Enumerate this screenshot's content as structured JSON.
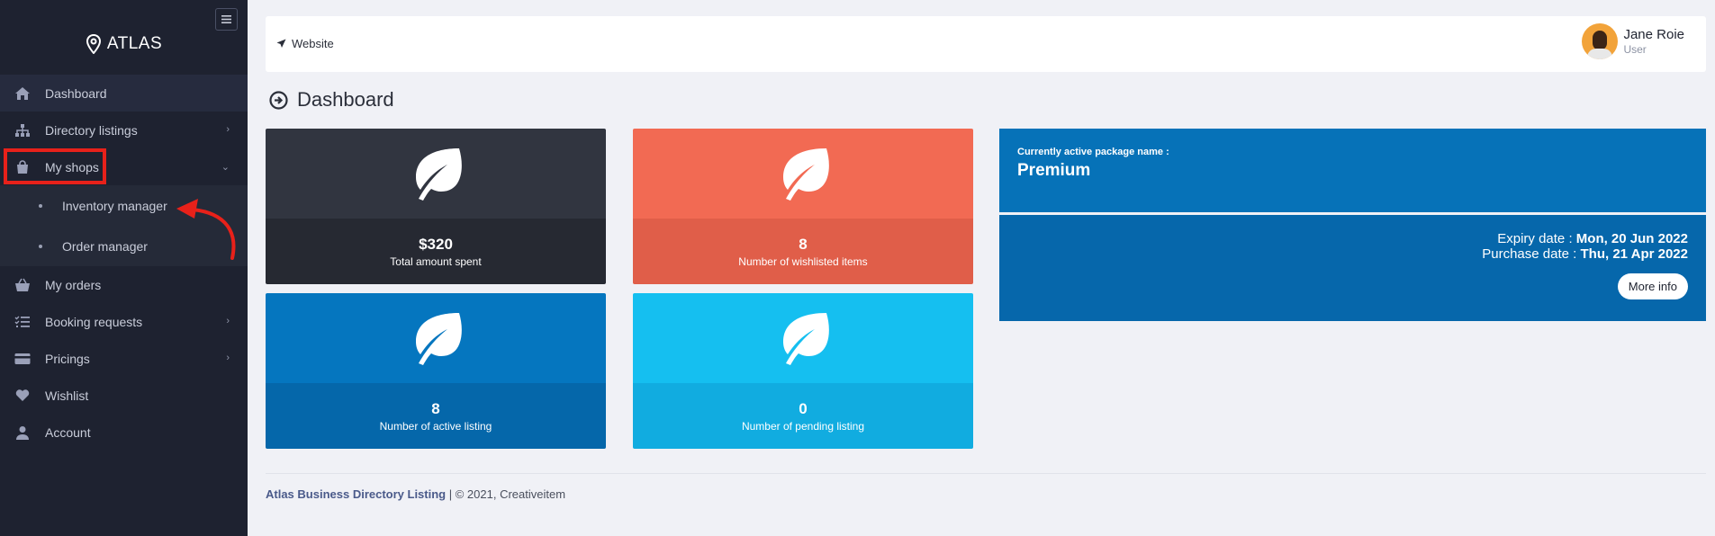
{
  "sidebar": {
    "brand": "ATLAS",
    "items": [
      {
        "label": "Dashboard",
        "icon": "home-icon"
      },
      {
        "label": "Directory listings",
        "icon": "sitemap-icon"
      },
      {
        "label": "My shops",
        "icon": "shopping-bag-icon"
      },
      {
        "label": "My orders",
        "icon": "basket-icon"
      },
      {
        "label": "Booking requests",
        "icon": "tasks-icon"
      },
      {
        "label": "Pricings",
        "icon": "credit-card-icon"
      },
      {
        "label": "Wishlist",
        "icon": "heart-icon"
      },
      {
        "label": "Account",
        "icon": "user-icon"
      }
    ],
    "submenu": [
      {
        "label": "Inventory manager"
      },
      {
        "label": "Order manager"
      }
    ]
  },
  "header": {
    "website_label": "Website",
    "user_name": "Jane Roie",
    "user_role": "User"
  },
  "page_title": "Dashboard",
  "stats": [
    {
      "value": "$320",
      "label": "Total amount spent",
      "icon": "leaf-icon"
    },
    {
      "value": "8",
      "label": "Number of wishlisted items",
      "icon": "leaf-icon"
    },
    {
      "value": "8",
      "label": "Number of active listing",
      "icon": "leaf-icon"
    },
    {
      "value": "0",
      "label": "Number of pending listing",
      "icon": "leaf-icon"
    }
  ],
  "package": {
    "caption": "Currently active package name :",
    "name": "Premium",
    "expiry_label": "Expiry date :",
    "expiry_value": "Mon, 20 Jun 2022",
    "purchase_label": "Purchase date :",
    "purchase_value": "Thu, 21 Apr 2022",
    "more_info": "More info"
  },
  "footer": {
    "brand": "Atlas Business Directory Listing",
    "rest": " | © 2021, ",
    "company": "Creativeitem"
  },
  "colors": {
    "sidebar_bg": "#1e2230",
    "card_dark": "#313540",
    "card_coral": "#f26a53",
    "card_blue": "#0576bf",
    "card_cyan": "#15bff0",
    "package_blue": "#0672b8",
    "annotation_red": "#e8211a"
  }
}
